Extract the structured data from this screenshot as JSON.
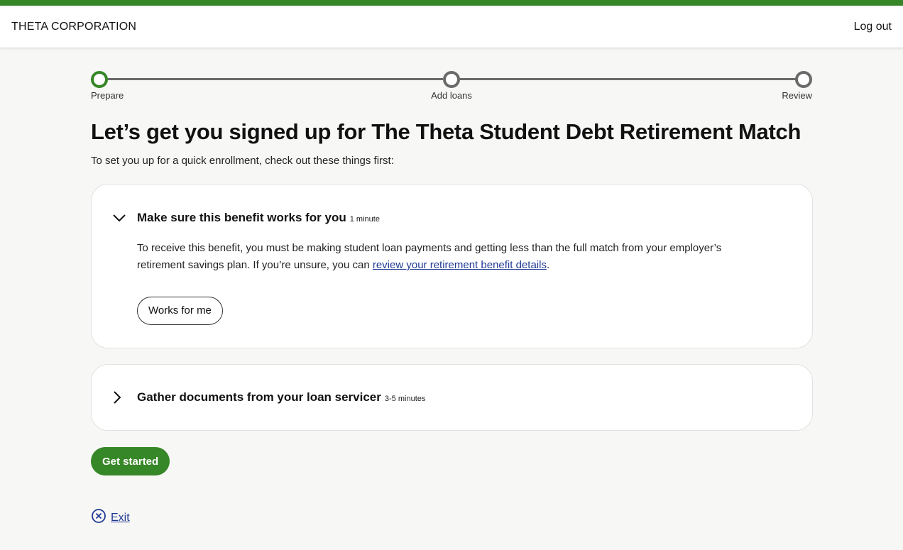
{
  "header": {
    "brand": "THETA CORPORATION",
    "logout_label": "Log out"
  },
  "colors": {
    "accent": "#368727",
    "link": "#1f3a93",
    "inactive": "#6a6a6a"
  },
  "stepper": {
    "steps": [
      {
        "label": "Prepare",
        "state": "current"
      },
      {
        "label": "Add loans",
        "state": "upcoming"
      },
      {
        "label": "Review",
        "state": "upcoming"
      }
    ]
  },
  "main": {
    "title": "Let’s get you signed up for The Theta Student Debt Retirement Match",
    "intro": "To set you up for a quick enrollment, check out these things first:"
  },
  "cards": [
    {
      "title": "Make sure this benefit works for you",
      "time": "1 minute",
      "expanded": true,
      "icon": "chevron-down-icon",
      "text_before": "To receive this benefit, you must be making student loan payments and getting less than the full match from your employer’s retirement savings plan. If you’re unsure, you can ",
      "link_text": "review your retirement benefit details",
      "text_after": ".",
      "button_label": "Works for me"
    },
    {
      "title": "Gather documents from your loan servicer",
      "time": "3-5 minutes",
      "expanded": false,
      "icon": "chevron-right-icon"
    }
  ],
  "actions": {
    "get_started_label": "Get started",
    "exit_label": "Exit",
    "exit_icon": "close-circle-icon"
  }
}
